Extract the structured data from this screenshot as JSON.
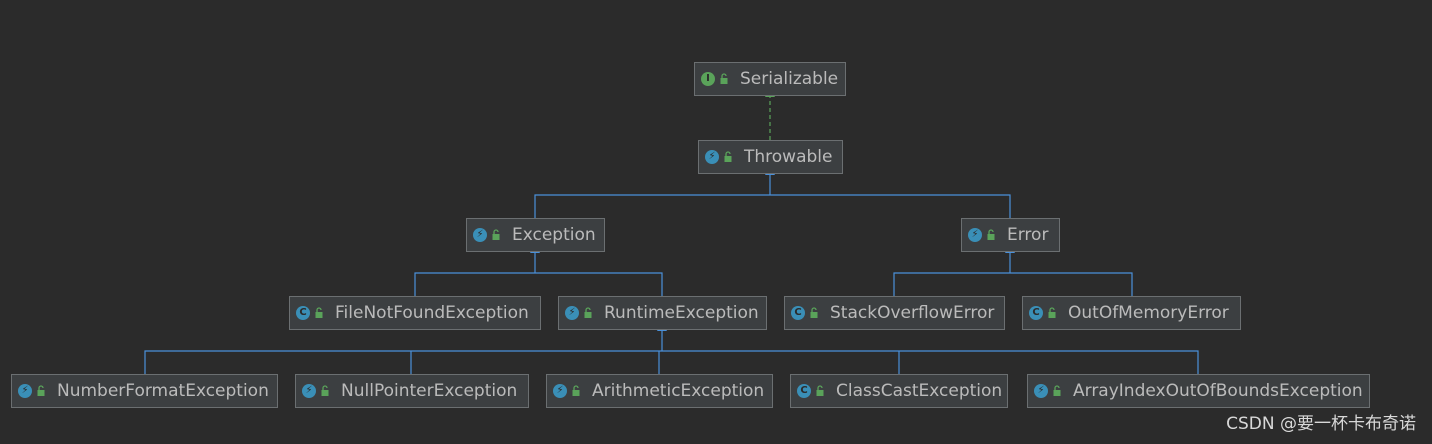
{
  "nodes": {
    "serializable": {
      "label": "Serializable",
      "kind": "interface",
      "icon": "interface-icon"
    },
    "throwable": {
      "label": "Throwable",
      "kind": "class",
      "icon": "class-icon"
    },
    "exception": {
      "label": "Exception",
      "kind": "class",
      "icon": "class-icon"
    },
    "error": {
      "label": "Error",
      "kind": "class",
      "icon": "class-icon"
    },
    "filenotfound": {
      "label": "FileNotFoundException",
      "kind": "class",
      "icon": "class-icon"
    },
    "runtime": {
      "label": "RuntimeException",
      "kind": "class",
      "icon": "class-icon"
    },
    "stackoverflow": {
      "label": "StackOverflowError",
      "kind": "class",
      "icon": "class-icon"
    },
    "outofmemory": {
      "label": "OutOfMemoryError",
      "kind": "class",
      "icon": "class-icon"
    },
    "numberformat": {
      "label": "NumberFormatException",
      "kind": "class",
      "icon": "class-icon"
    },
    "nullpointer": {
      "label": "NullPointerException",
      "kind": "class",
      "icon": "class-icon"
    },
    "arithmetic": {
      "label": "ArithmeticException",
      "kind": "class",
      "icon": "class-icon"
    },
    "classcast": {
      "label": "ClassCastException",
      "kind": "class",
      "icon": "class-icon"
    },
    "arrayindex": {
      "label": "ArrayIndexOutOfBoundsException",
      "kind": "class",
      "icon": "class-icon"
    }
  },
  "colors": {
    "background": "#2b2b2b",
    "node_fill": "#3c3f41",
    "node_border": "#6b6f71",
    "text": "#bbbbbb",
    "extends_edge": "#4a90d9",
    "implements_edge": "#5aa35a",
    "class_icon": "#3a8fb7",
    "interface_icon": "#5aa35a"
  },
  "watermark": "CSDN @要一杯卡布奇诺"
}
